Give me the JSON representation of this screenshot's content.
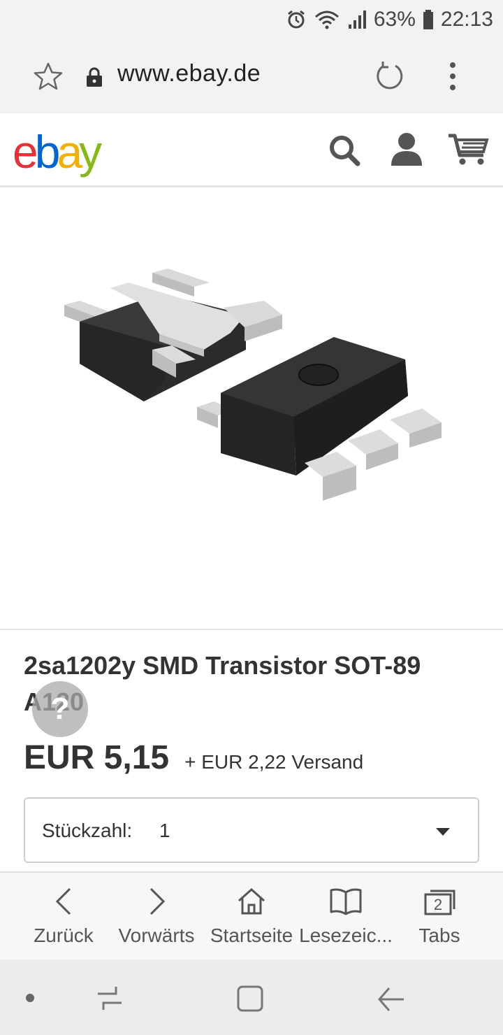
{
  "status_bar": {
    "battery_percent": "63%",
    "time": "22:13",
    "icons": [
      "alarm-icon",
      "wifi-icon",
      "signal-icon",
      "battery-icon"
    ]
  },
  "browser": {
    "url": "www.ebay.de",
    "icons": [
      "star-icon",
      "lock-icon",
      "reload-icon",
      "more-vert-icon"
    ]
  },
  "ebay_header": {
    "logo_letters": [
      "e",
      "b",
      "a",
      "y"
    ],
    "logo_colors": [
      "#e53238",
      "#0064d2",
      "#f5af02",
      "#86b817"
    ],
    "icons": [
      "search-icon",
      "user-icon",
      "cart-icon"
    ]
  },
  "product": {
    "title": "2sa1202y SMD Transistor SOT-89 A120",
    "help_glyph": "?",
    "price": "EUR 5,15",
    "shipping": "+ EUR 2,22 Versand",
    "quantity_label": "Stückzahl:",
    "quantity_value": "1"
  },
  "bottom_nav": {
    "back": "Zurück",
    "forward": "Vorwärts",
    "home": "Startseite",
    "bookmarks": "Lesezeic...",
    "tabs": "Tabs",
    "tabs_count": "2"
  },
  "colors": {
    "accent_text": "#333333",
    "toolbar_bg": "#f2f2f2"
  }
}
